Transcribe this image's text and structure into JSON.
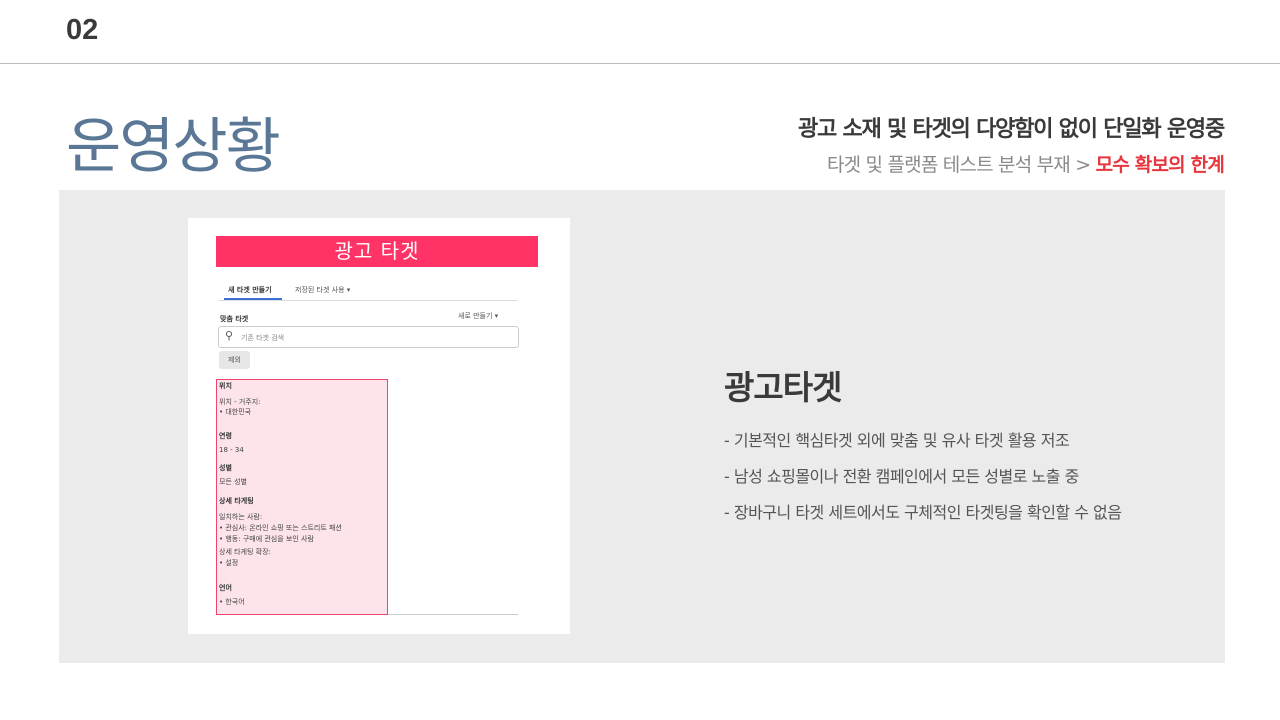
{
  "slide_number": "02",
  "title": "운영상황",
  "subheading": "광고 소재 및 타겟의 다양함이 없이 단일화 운영중",
  "subheading2_plain": "타겟 및 플랫폼 테스트 분석 부재 >",
  "subheading2_highlight": "모수 확보의 한계",
  "highlight_color": "#e8363e",
  "screenshot": {
    "header": "광고 타겟",
    "tab_new": "새 타겟 만들기",
    "tab_saved": "저장된 타겟 사용 ▾",
    "custom_target_label": "맞춤 타겟",
    "create_new": "새로 만들기 ▾",
    "search_placeholder": "기존 타겟 검색",
    "search_icon": "search-icon",
    "exclude_button": "제외",
    "details": {
      "location_heading": "위치",
      "location_sub": "위치 - 거주지:",
      "location_value": "• 대한민국",
      "age_heading": "연령",
      "age_value": "18 - 34",
      "gender_heading": "성별",
      "gender_value": "모든 성별",
      "detailed_heading": "상세 타게팅",
      "match_label": "일치하는 사람:",
      "interest": "• 관심사: 온라인 쇼핑 또는 스트리트 패션",
      "behavior": "• 행동: 구매에 관심을 보인 사람",
      "expand_label": "상세 타게팅 확장:",
      "expand_value": "• 설정",
      "language_heading": "언어",
      "language_value": "• 한국어"
    }
  },
  "right": {
    "title": "광고타겟",
    "bullets": [
      "- 기본적인 핵심타겟 외에 맞춤 및 유사 타겟 활용 저조",
      "- 남성 쇼핑몰이나 전환 캠페인에서 모든 성별로 노출 중",
      "- 장바구니 타겟 세트에서도 구체적인 타겟팅을 확인할 수 없음"
    ]
  }
}
